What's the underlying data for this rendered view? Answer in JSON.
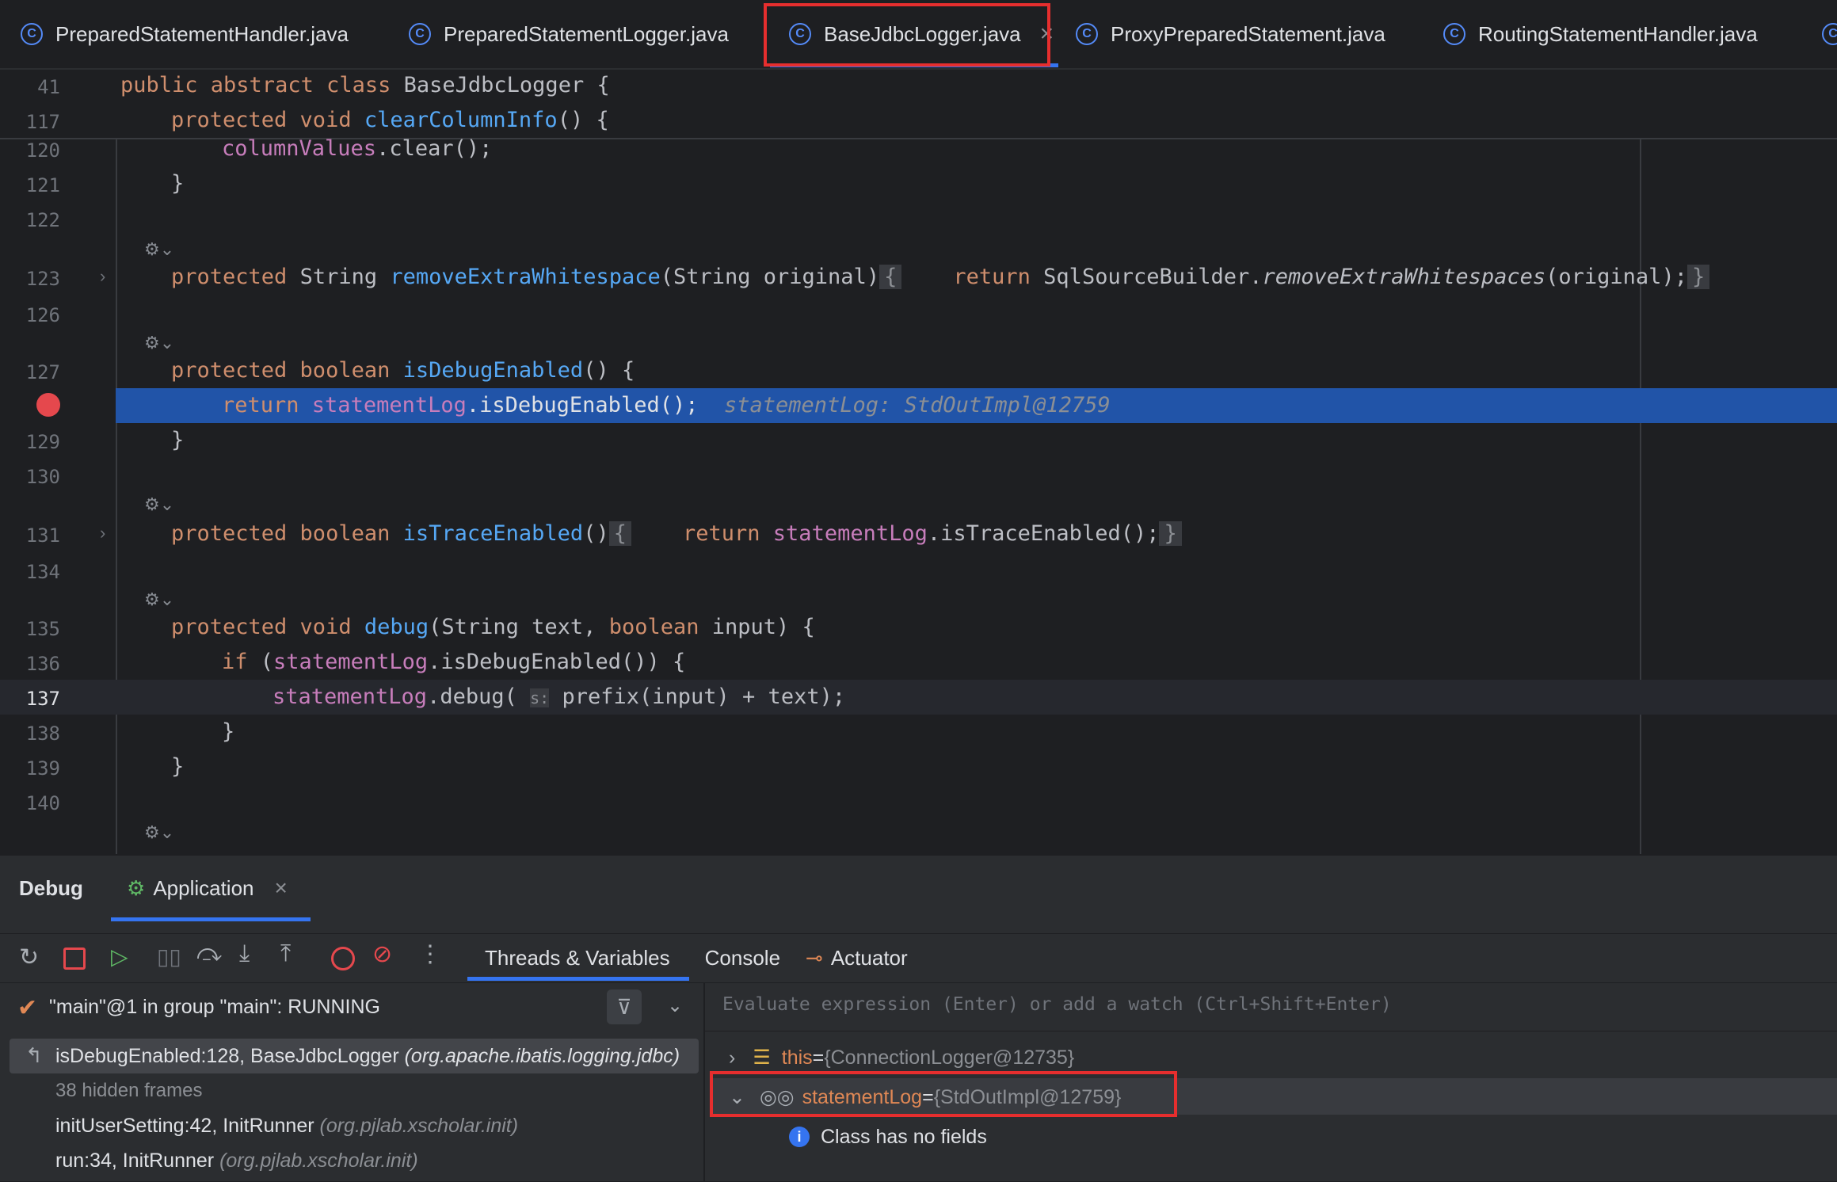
{
  "tabs": [
    {
      "label": "PreparedStatementHandler.java",
      "active": false
    },
    {
      "label": "PreparedStatementLogger.java",
      "active": false
    },
    {
      "label": "BaseJdbcLogger.java",
      "active": true
    },
    {
      "label": "ProxyPreparedStatement.java",
      "active": false
    },
    {
      "label": "RoutingStatementHandler.java",
      "active": false
    }
  ],
  "editor": {
    "sticky": [
      {
        "num": "41"
      },
      {
        "num": "117"
      }
    ],
    "line_numbers": [
      "120",
      "121",
      "122",
      "123",
      "126",
      "127",
      "129",
      "130",
      "131",
      "134",
      "135",
      "136",
      "137",
      "138",
      "139",
      "140"
    ],
    "inline_value": "statementLog: StdOutImpl@12759",
    "param_hint": "s:"
  },
  "debug": {
    "title": "Debug",
    "session_tab": "Application",
    "subtabs": [
      "Threads & Variables",
      "Console",
      "Actuator"
    ],
    "thread": "\"main\"@1 in group \"main\": RUNNING",
    "frames": [
      {
        "method": "isDebugEnabled:128, BaseJdbcLogger",
        "pkg": "(org.apache.ibatis.logging.jdbc)"
      },
      {
        "method": "38 hidden frames",
        "pkg": ""
      },
      {
        "method": "initUserSetting:42, InitRunner",
        "pkg": "(org.pjlab.xscholar.init)"
      },
      {
        "method": "run:34, InitRunner",
        "pkg": "(org.pjlab.xscholar.init)"
      }
    ],
    "eval_placeholder": "Evaluate expression (Enter) or add a watch (Ctrl+Shift+Enter)",
    "variables": [
      {
        "name": "this",
        "eq": " = ",
        "value": "{ConnectionLogger@12735}"
      },
      {
        "name": "statementLog",
        "eq": " = ",
        "value": "{StdOutImpl@12759}"
      }
    ],
    "info": "Class has no fields"
  },
  "colors": {
    "accent": "#3574f0",
    "highlight_line": "#2154a8",
    "annotation_red": "#e62e2e"
  }
}
